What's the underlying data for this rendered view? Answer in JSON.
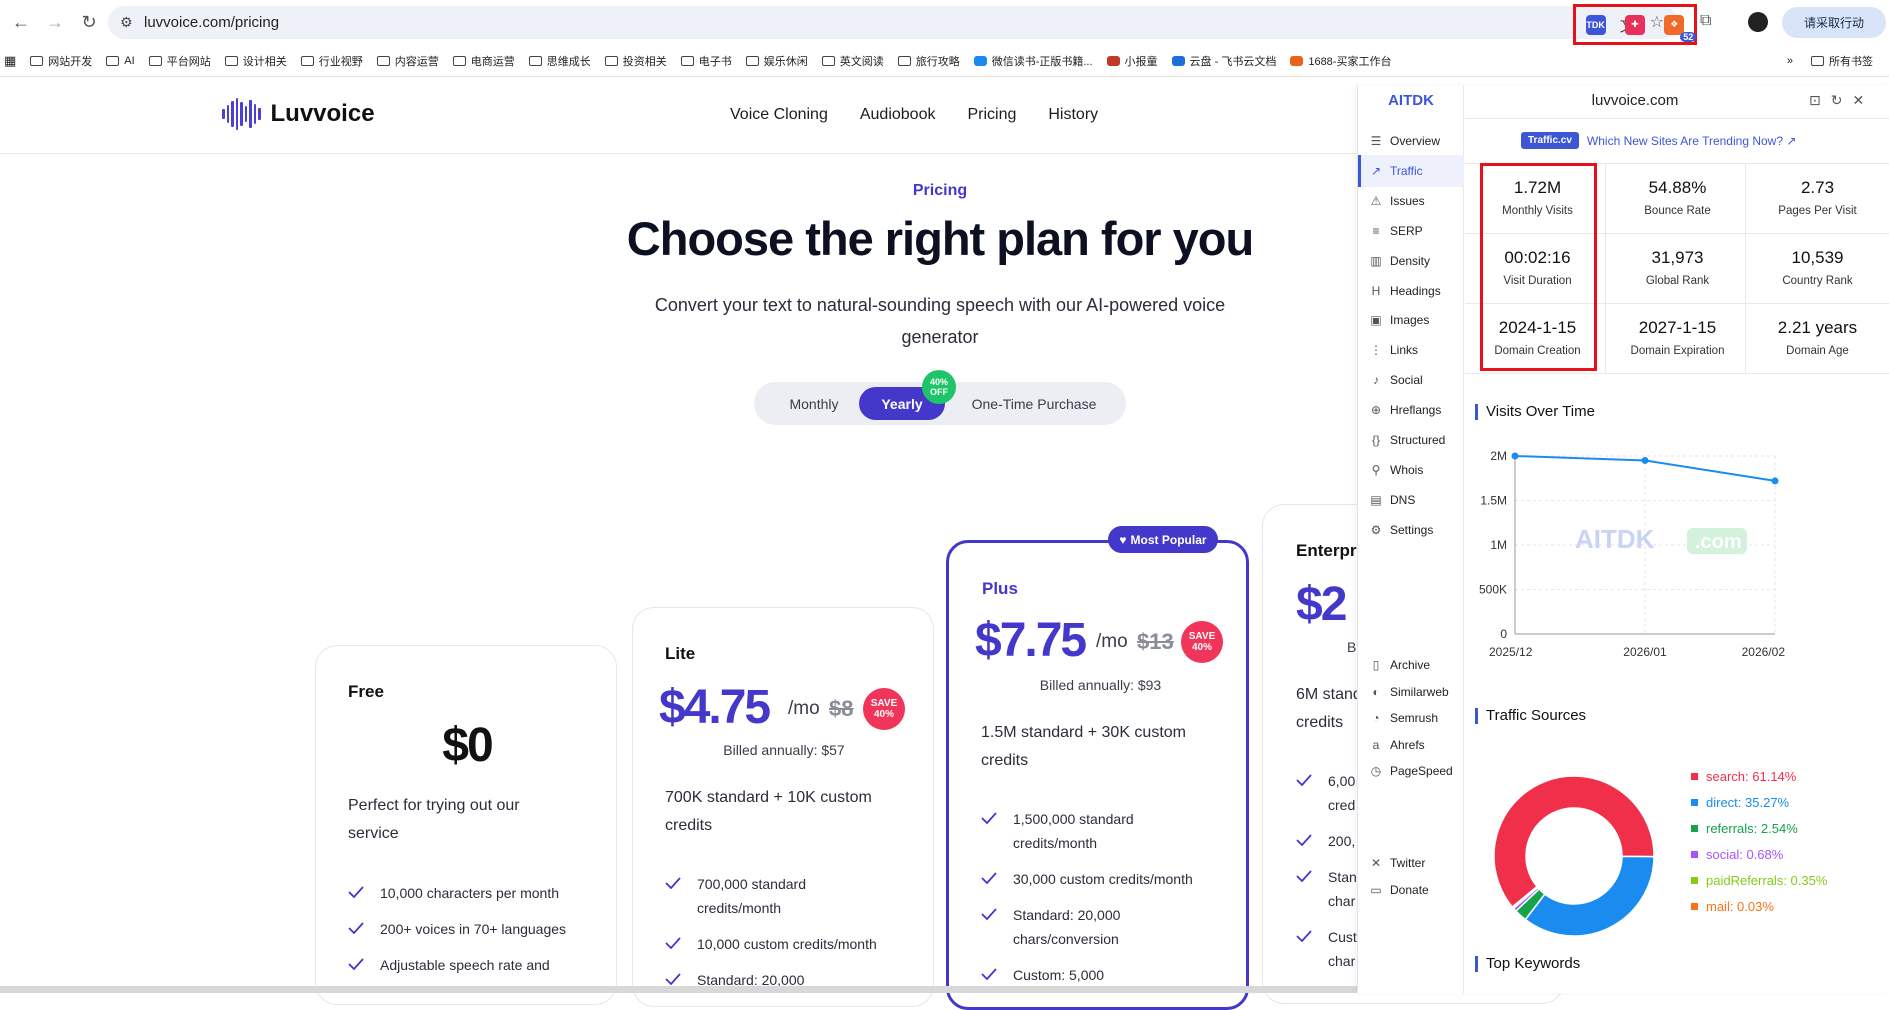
{
  "browser": {
    "url": "luvvoice.com/pricing",
    "action_button": "请采取行动",
    "ext_badge": "52",
    "ext1": "TDK",
    "bookmarks": [
      "网站开发",
      "AI",
      "平台网站",
      "设计相关",
      "行业视野",
      "内容运营",
      "电商运营",
      "思维成长",
      "投资相关",
      "电子书",
      "娱乐休闲",
      "英文阅读",
      "旅行攻略",
      "微信读书-正版书籍...",
      "小报童",
      "云盘 - 飞书云文档",
      "1688-买家工作台"
    ],
    "bookmarks_more": "»",
    "bookmarks_all": "所有书签"
  },
  "site": {
    "brand": "Luvvoice",
    "nav": [
      "Voice Cloning",
      "Audiobook",
      "Pricing",
      "History"
    ],
    "section_label": "Pricing",
    "title": "Choose the right plan for you",
    "subtitle": "Convert your text to natural-sounding speech with our AI-powered voice generator",
    "toggle": {
      "monthly": "Monthly",
      "yearly": "Yearly",
      "onetime": "One-Time Purchase",
      "badge": "40% OFF"
    },
    "popular": "Most Popular",
    "plans": {
      "free": {
        "name": "Free",
        "price": "$0",
        "desc": "Perfect for trying out our service",
        "features": [
          "10,000 characters per month",
          "200+ voices in 70+ languages",
          "Adjustable speech rate and"
        ]
      },
      "lite": {
        "name": "Lite",
        "price": "$4.75",
        "per": "/mo",
        "old": "$8",
        "save": "SAVE 40%",
        "billed": "Billed annually: $57",
        "desc": "700K standard + 10K custom credits",
        "features": [
          "700,000 standard credits/month",
          "10,000 custom credits/month",
          "Standard: 20,000"
        ]
      },
      "plus": {
        "name": "Plus",
        "price": "$7.75",
        "per": "/mo",
        "old": "$13",
        "save": "SAVE 40%",
        "billed": "Billed annually: $93",
        "desc": "1.5M standard + 30K custom credits",
        "features": [
          "1,500,000 standard credits/month",
          "30,000 custom credits/month",
          "Standard: 20,000 chars/conversion",
          "Custom: 5,000"
        ]
      },
      "enterprise": {
        "name": "Enterpri",
        "price": "$2",
        "billed": "B",
        "desc": "6M stand credits",
        "features": [
          "6,00 cred",
          "200,",
          "Stan char",
          "Cust char"
        ]
      }
    }
  },
  "panel": {
    "brand": "AITDK",
    "domain": "luvvoice.com",
    "menu": [
      "Overview",
      "Traffic",
      "Issues",
      "SERP",
      "Density",
      "Headings",
      "Images",
      "Links",
      "Social",
      "Hreflangs",
      "Structured",
      "Whois",
      "DNS",
      "Settings"
    ],
    "menu2": [
      "Archive",
      "Similarweb",
      "Semrush",
      "Ahrefs",
      "PageSpeed"
    ],
    "menu3": [
      "Twitter",
      "Donate"
    ],
    "trend_tag": "Traffic.cv",
    "trend_text": "Which New Sites Are Trending Now? ↗",
    "stats": [
      {
        "value": "1.72M",
        "label": "Monthly Visits"
      },
      {
        "value": "54.88%",
        "label": "Bounce Rate"
      },
      {
        "value": "2.73",
        "label": "Pages Per Visit"
      },
      {
        "value": "00:02:16",
        "label": "Visit Duration"
      },
      {
        "value": "31,973",
        "label": "Global Rank"
      },
      {
        "value": "10,539",
        "label": "Country Rank"
      },
      {
        "value": "2024-1-15",
        "label": "Domain Creation"
      },
      {
        "value": "2027-1-15",
        "label": "Domain Expiration"
      },
      {
        "value": "2.21 years",
        "label": "Domain Age"
      }
    ],
    "visits_title": "Visits Over Time",
    "watermark": "AITDK",
    "watermark_suffix": ".com",
    "sources_title": "Traffic Sources",
    "keywords_title": "Top Keywords"
  },
  "chart_data": [
    {
      "type": "line",
      "title": "Visits Over Time",
      "x": [
        "2025/12",
        "2026/01",
        "2026/02"
      ],
      "series": [
        {
          "values": [
            2000000,
            1950000,
            1720000
          ]
        }
      ],
      "ylim": [
        0,
        2000000
      ],
      "yticks": [
        "0",
        "500K",
        "1M",
        "1.5M",
        "2M"
      ],
      "color": "#1a8cf0",
      "grid": true
    },
    {
      "type": "pie",
      "title": "Traffic Sources",
      "slices": [
        {
          "name": "search",
          "value": 61.14,
          "label": "search: 61.14%",
          "color": "#f0304a"
        },
        {
          "name": "direct",
          "value": 35.27,
          "label": "direct: 35.27%",
          "color": "#1a8cf0"
        },
        {
          "name": "referrals",
          "value": 2.54,
          "label": "referrals: 2.54%",
          "color": "#16a34a"
        },
        {
          "name": "social",
          "value": 0.68,
          "label": "social: 0.68%",
          "color": "#a855f7"
        },
        {
          "name": "paidReferrals",
          "value": 0.35,
          "label": "paidReferrals: 0.35%",
          "color": "#84cc16"
        },
        {
          "name": "mail",
          "value": 0.03,
          "label": "mail: 0.03%",
          "color": "#f97316"
        }
      ]
    }
  ]
}
